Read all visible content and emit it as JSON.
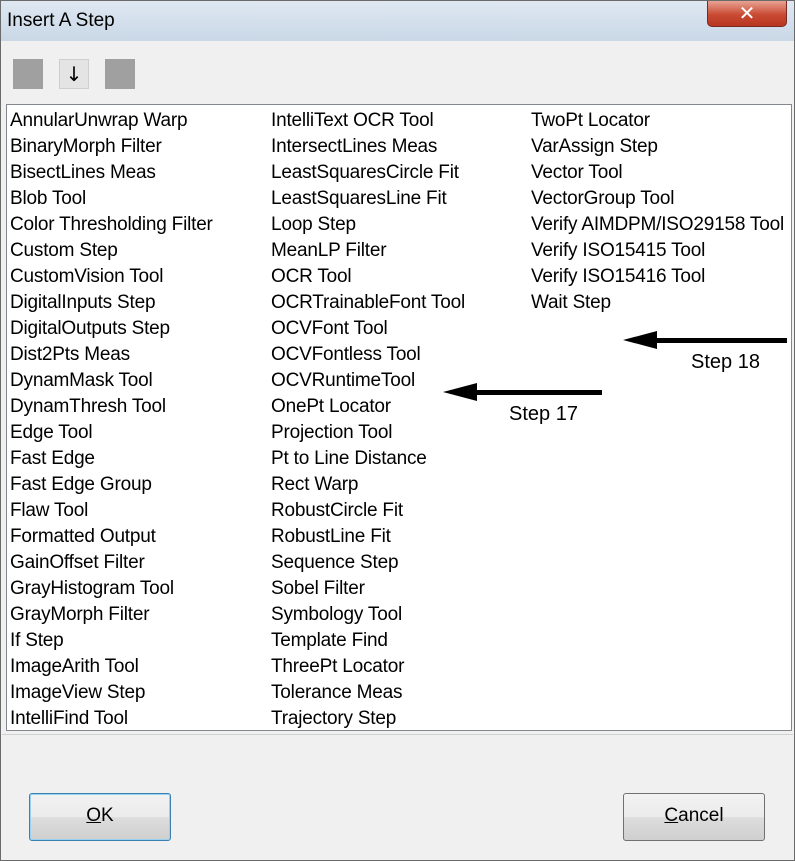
{
  "window": {
    "title": "Insert A Step",
    "close_glyph": "✕"
  },
  "toolbar": {
    "down_glyph": "↓"
  },
  "list": {
    "columns": [
      [
        "AnnularUnwrap Warp",
        "BinaryMorph Filter",
        "BisectLines Meas",
        "Blob Tool",
        "Color Thresholding Filter",
        "Custom Step",
        "CustomVision Tool",
        "DigitalInputs Step",
        "DigitalOutputs Step",
        "Dist2Pts Meas",
        "DynamMask Tool",
        "DynamThresh Tool",
        "Edge Tool",
        "Fast Edge",
        "Fast Edge Group",
        "Flaw Tool",
        "Formatted Output",
        "GainOffset Filter",
        "GrayHistogram Tool",
        "GrayMorph Filter",
        "If Step",
        "ImageArith Tool",
        "ImageView Step",
        "IntelliFind Tool"
      ],
      [
        "IntelliText OCR Tool",
        "IntersectLines Meas",
        "LeastSquaresCircle Fit",
        "LeastSquaresLine Fit",
        "Loop Step",
        "MeanLP Filter",
        "OCR Tool",
        "OCRTrainableFont Tool",
        "OCVFont Tool",
        "OCVFontless Tool",
        "OCVRuntimeTool",
        "OnePt Locator",
        "Projection Tool",
        "Pt to Line Distance",
        "Rect Warp",
        "RobustCircle Fit",
        "RobustLine Fit",
        "Sequence Step",
        "Sobel Filter",
        "Symbology Tool",
        "Template Find",
        "ThreePt Locator",
        "Tolerance Meas",
        "Trajectory Step"
      ],
      [
        "TwoPt Locator",
        "VarAssign Step",
        "Vector Tool",
        "VectorGroup Tool",
        "Verify AIMDPM/ISO29158 Tool",
        "Verify ISO15415 Tool",
        "Verify ISO15416 Tool",
        "Wait Step"
      ]
    ]
  },
  "annotations": {
    "step17": "Step 17",
    "step18": "Step 18"
  },
  "buttons": {
    "ok_mnemonic": "O",
    "ok_rest": "K",
    "cancel_mnemonic": "C",
    "cancel_rest": "ancel"
  }
}
